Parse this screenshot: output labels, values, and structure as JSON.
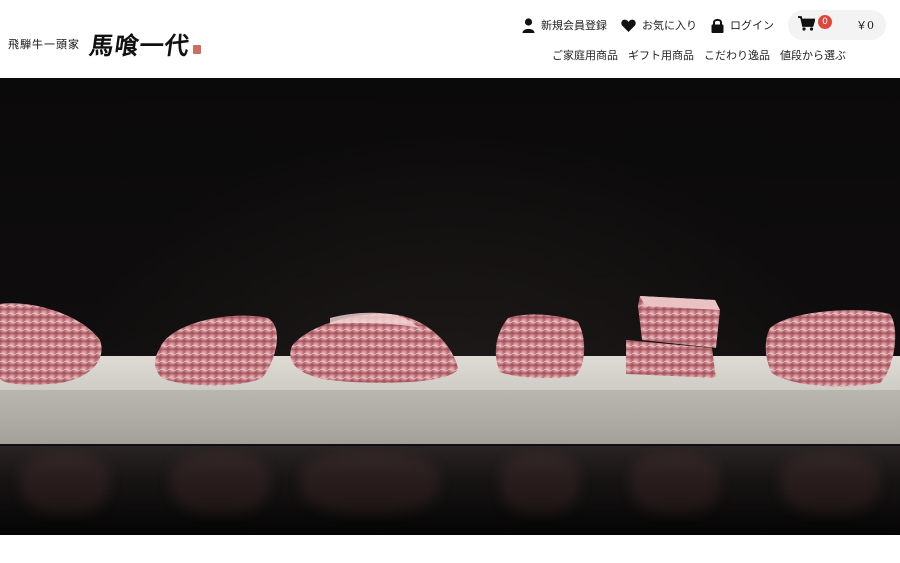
{
  "brand": {
    "subtitle": "飛騨牛一頭家",
    "logo_text": "馬喰一代"
  },
  "util_nav": {
    "register": "新規会員登録",
    "favorites": "お気に入り",
    "login": "ログイン"
  },
  "cart": {
    "count": "0",
    "total": "￥0"
  },
  "main_nav": [
    "ご家庭用商品",
    "ギフト用商品",
    "こだわり逸品",
    "値段から選ぶ"
  ],
  "colors": {
    "badge": "#e0473a",
    "hero_bg": "#0b0a0a",
    "slab": "#d8d5ce"
  },
  "icons": {
    "user": "user-icon",
    "heart": "heart-icon",
    "lock": "lock-icon",
    "cart": "cart-icon"
  }
}
